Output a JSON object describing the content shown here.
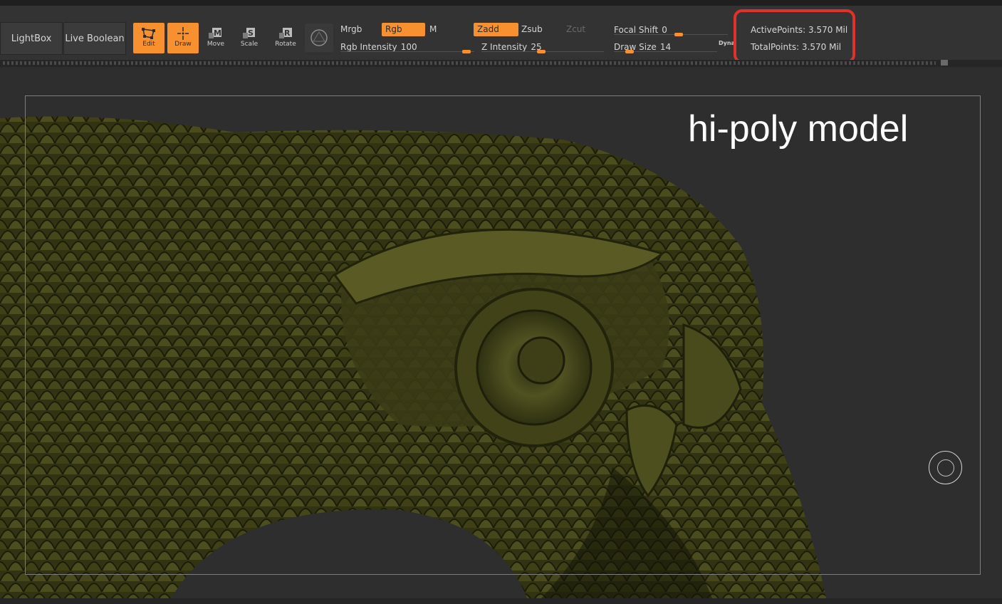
{
  "toolbar": {
    "lightbox": "LightBox",
    "live_boolean": "Live Boolean",
    "tools": [
      {
        "label": "Edit",
        "icon": "edit-icon",
        "active": true
      },
      {
        "label": "Draw",
        "icon": "draw-icon",
        "active": true
      },
      {
        "label": "Move",
        "icon": "move-icon",
        "active": false
      },
      {
        "label": "Scale",
        "icon": "scale-icon",
        "active": false
      },
      {
        "label": "Rotate",
        "icon": "rotate-icon",
        "active": false
      }
    ],
    "modes": {
      "mrgb": "Mrgb",
      "rgb": "Rgb",
      "m": "M",
      "zadd": "Zadd",
      "zsub": "Zsub",
      "zcut": "Zcut"
    },
    "rgb_intensity": {
      "label": "Rgb Intensity",
      "value": "100"
    },
    "z_intensity": {
      "label": "Z Intensity",
      "value": "25"
    },
    "focal_shift": {
      "label": "Focal Shift",
      "value": "0"
    },
    "draw_size": {
      "label": "Draw Size",
      "value": "14"
    },
    "dynamic": "Dynamic"
  },
  "stats": {
    "active_points": "ActivePoints: 3.570 Mil",
    "total_points": "TotalPoints: 3.570 Mil"
  },
  "viewport": {
    "caption": "hi-poly model"
  },
  "colors": {
    "accent": "#f7902f",
    "highlight": "#e0312c",
    "model": "#4a4a1c"
  }
}
